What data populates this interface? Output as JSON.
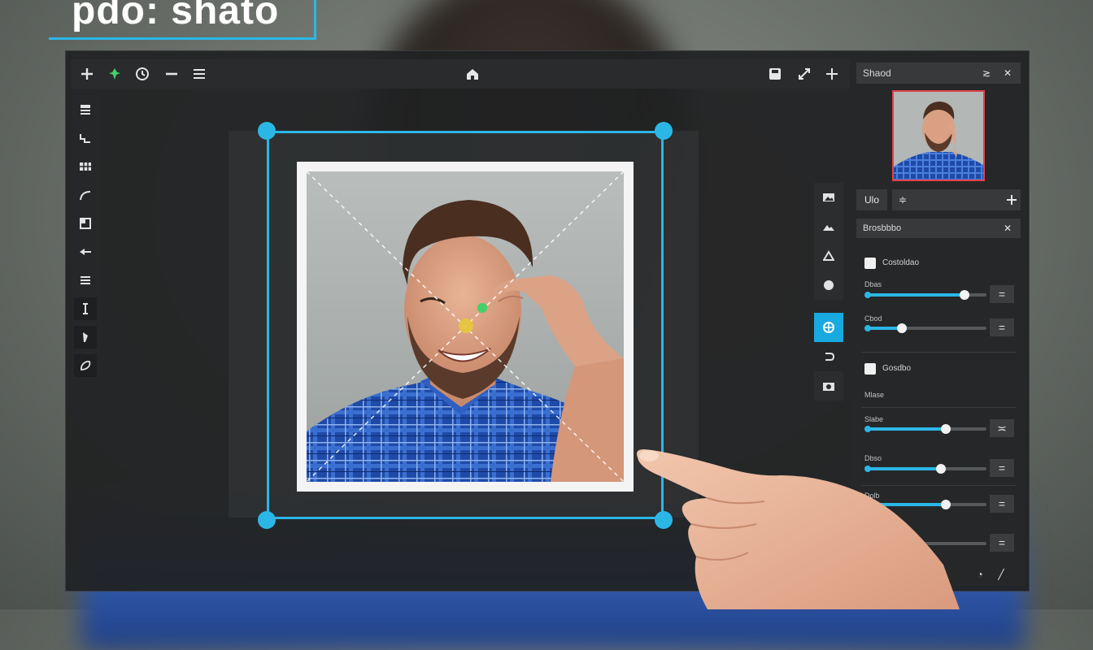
{
  "title": "pdo: shato",
  "toolbar": {
    "left_icons": [
      "plus-icon",
      "pin-icon",
      "clock-icon",
      "minus-icon",
      "menu-icon"
    ],
    "center_icon": "home-icon",
    "right_icons": [
      "save-icon",
      "resize-icon",
      "plus-icon"
    ]
  },
  "left_tools": [
    "layers-icon",
    "stairs-icon",
    "grid-icon",
    "curve-icon",
    "frame-icon",
    "arrow-icon",
    "lines-icon",
    "text-cursor-icon",
    "pen-icon",
    "lasso-icon"
  ],
  "right_tools": [
    "image-icon",
    "landscape-icon",
    "triangle-icon",
    "circle-icon",
    "crop-icon",
    "undo-icon",
    "camera-icon"
  ],
  "panel": {
    "header_label": "Shaod",
    "sub_label": "Ulo",
    "section1": {
      "header": "Brosbbbo",
      "group1_label": "Costoldao",
      "slider1_label": "Dbas",
      "slider1_value": 0.82,
      "slider2_label": "Cbod",
      "slider2_value": 0.2,
      "group2_label": "Gosdbo",
      "group2_sub": "Mlase",
      "slider3_label": "Slabe",
      "slider3_value": 0.66,
      "slider4_label": "Dbso",
      "slider4_value": 0.62,
      "slider5_label": "Dolb",
      "slider5_value": 0.66
    }
  },
  "colors": {
    "accent": "#2bb7e6",
    "active_tool": "#18a9e0",
    "thumb_border": "#e0424a",
    "green_dot": "#43d16a",
    "yellow_dot": "#e7c83a"
  }
}
